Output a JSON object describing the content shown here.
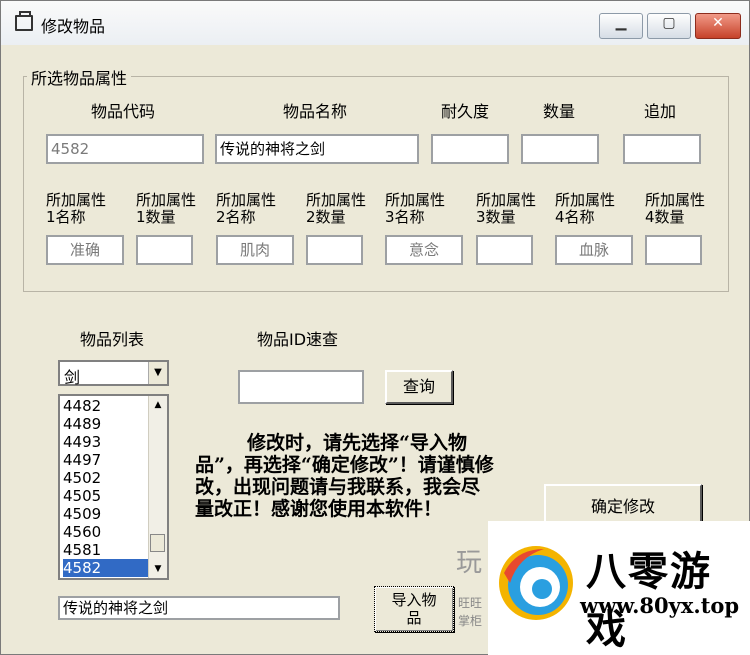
{
  "window": {
    "title": "修改物品"
  },
  "group": {
    "title": "所选物品属性"
  },
  "fields": {
    "code_label": "物品代码",
    "name_label": "物品名称",
    "durability_label": "耐久度",
    "quantity_label": "数量",
    "addon_label": "追加",
    "code_value": "4582",
    "name_value": "传说的神将之剑",
    "durability_value": "",
    "quantity_value": "",
    "addon_value": ""
  },
  "attributes": [
    {
      "name_label": "所加属性\n1名称",
      "qty_label": "所加属性\n1数量",
      "name_value": "准确",
      "qty_value": ""
    },
    {
      "name_label": "所加属性\n2名称",
      "qty_label": "所加属性\n2数量",
      "name_value": "肌肉",
      "qty_value": ""
    },
    {
      "name_label": "所加属性\n3名称",
      "qty_label": "所加属性\n3数量",
      "name_value": "意念",
      "qty_value": ""
    },
    {
      "name_label": "所加属性\n4名称",
      "qty_label": "所加属性\n4数量",
      "name_value": "血脉",
      "qty_value": ""
    }
  ],
  "item_list": {
    "label": "物品列表",
    "category": "剑",
    "items": [
      "4482",
      "4489",
      "4493",
      "4497",
      "4502",
      "4505",
      "4509",
      "4560",
      "4581",
      "4582"
    ],
    "selected": "4582",
    "selected_name": "传说的神将之剑"
  },
  "search": {
    "label": "物品ID速查",
    "value": "",
    "button": "查询"
  },
  "notice": {
    "first": "修改时，请先选择“导",
    "rest": "入物品”，再选择“确定修改”！请谨慎修改，出现问题请与我联系，我会尽量改正！感谢您使用本软件！"
  },
  "buttons": {
    "confirm": "确定修改",
    "import_l1": "导入物",
    "import_l2": "品"
  },
  "watermark": {
    "brand": "八零游戏",
    "url": "www.80yx.top",
    "fragment1": "玩",
    "fragment2": "旺旺",
    "fragment3": "掌柜"
  },
  "colors": {
    "selection": "#316ac5",
    "face": "#ece9d8",
    "close": "#c6422a"
  }
}
